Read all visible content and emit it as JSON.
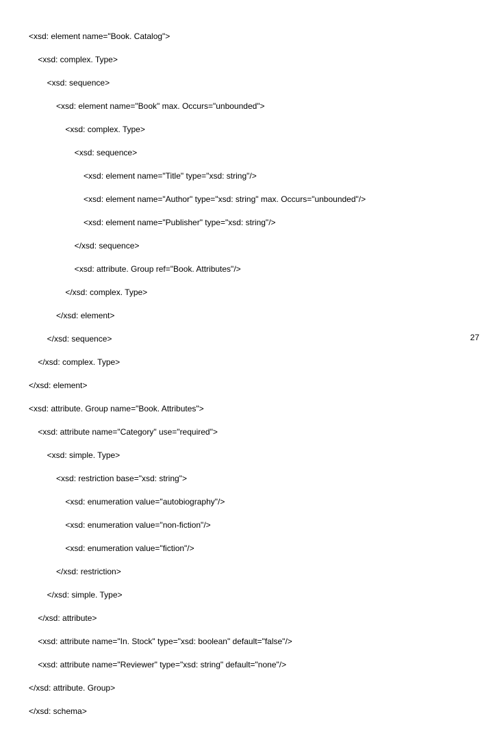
{
  "code": {
    "l01": "<xsd: element name=\"Book. Catalog\">",
    "l02": "    <xsd: complex. Type>",
    "l03": "        <xsd: sequence>",
    "l04": "            <xsd: element name=\"Book\" max. Occurs=\"unbounded\">",
    "l05": "                <xsd: complex. Type>",
    "l06": "                    <xsd: sequence>",
    "l07": "                        <xsd: element name=\"Title\" type=\"xsd: string\"/>",
    "l08": "                        <xsd: element name=\"Author\" type=\"xsd: string\" max. Occurs=\"unbounded\"/>",
    "l09": "                        <xsd: element name=\"Publisher\" type=\"xsd: string\"/>",
    "l10": "                    </xsd: sequence>",
    "l11": "                    <xsd: attribute. Group ref=\"Book. Attributes\"/>",
    "l12": "                </xsd: complex. Type>",
    "l13": "            </xsd: element>",
    "l14": "        </xsd: sequence>",
    "l15": "    </xsd: complex. Type>",
    "l16": "</xsd: element>",
    "l17": "<xsd: attribute. Group name=\"Book. Attributes\">",
    "l18": "    <xsd: attribute name=\"Category\" use=\"required\">",
    "l19": "        <xsd: simple. Type>",
    "l20": "            <xsd: restriction base=\"xsd: string\">",
    "l21": "                <xsd: enumeration value=\"autobiography\"/>",
    "l22": "                <xsd: enumeration value=\"non-fiction\"/>",
    "l23": "                <xsd: enumeration value=\"fiction\"/>",
    "l24": "            </xsd: restriction>",
    "l25": "        </xsd: simple. Type>",
    "l26": "    </xsd: attribute>",
    "l27": "    <xsd: attribute name=\"In. Stock\" type=\"xsd: boolean\" default=\"false\"/>",
    "l28": "    <xsd: attribute name=\"Reviewer\" type=\"xsd: string\" default=\"none\"/>",
    "l29": "</xsd: attribute. Group>",
    "l30": "</xsd: schema>"
  },
  "page_number": "27"
}
